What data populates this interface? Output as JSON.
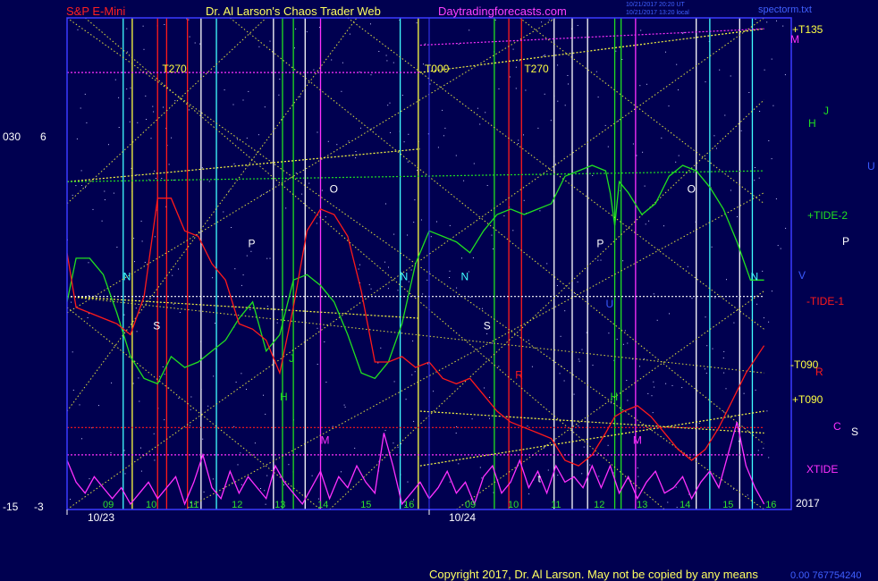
{
  "header": {
    "left": "S&P E-Mini",
    "center": "Dr. Al Larson's Chaos Trader Web",
    "site": "Daytradingforecasts.com",
    "stamp1": "10/21/2017 20:20 UT",
    "stamp2": "10/21/2017 13:20 local",
    "file": "spectorm.txt"
  },
  "footer": {
    "copyright": "Copyright 2017, Dr. Al Larson. May not be copied by any means",
    "code": "0.00 767754240",
    "year": "2017"
  },
  "colors": {
    "background": "#000050",
    "plot_border": "#3a3aff",
    "red": "#ff1a1a",
    "green": "#20e020",
    "magenta": "#ff30ff",
    "yellow": "#ffff40",
    "cyan": "#40ffff",
    "white": "#ffffff"
  },
  "chart_data": {
    "type": "line",
    "title": "",
    "xlabel": "",
    "ylabel": "",
    "x_range": [
      8,
      16
    ],
    "y_scales": [
      {
        "top": "030",
        "bottom": "-15"
      },
      {
        "top": "6",
        "bottom": "-3"
      }
    ],
    "dates": [
      "10/23",
      "10/24"
    ],
    "hour_ticks": [
      "09",
      "10",
      "11",
      "12",
      "13",
      "14",
      "15",
      "16",
      "09",
      "10",
      "11",
      "12",
      "13",
      "14",
      "15",
      "16"
    ],
    "right_labels": [
      {
        "text": "+T135",
        "color": "yellow"
      },
      {
        "text": "M",
        "color": "magenta"
      },
      {
        "text": "J",
        "color": "green"
      },
      {
        "text": "H",
        "color": "green"
      },
      {
        "text": "U",
        "color": "blue"
      },
      {
        "text": "+TIDE-2",
        "color": "green"
      },
      {
        "text": "P",
        "color": "white"
      },
      {
        "text": "V",
        "color": "blue"
      },
      {
        "text": "-TIDE-1",
        "color": "red"
      },
      {
        "text": "-T090",
        "color": "yellow"
      },
      {
        "text": "R",
        "color": "red"
      },
      {
        "text": "+T090",
        "color": "yellow"
      },
      {
        "text": "C",
        "color": "magenta"
      },
      {
        "text": "S",
        "color": "white"
      },
      {
        "text": "XTIDE",
        "color": "magenta"
      }
    ],
    "vertical_markers": [
      {
        "x": 8.62,
        "color": "cyan"
      },
      {
        "x": 8.72,
        "color": "yellow"
      },
      {
        "x": 9.0,
        "color": "red"
      },
      {
        "x": 9.1,
        "color": "red"
      },
      {
        "x": 9.33,
        "color": "red"
      },
      {
        "x": 9.48,
        "color": "white"
      },
      {
        "x": 9.65,
        "color": "cyan"
      },
      {
        "x": 10.28,
        "color": "white"
      },
      {
        "x": 10.38,
        "color": "green"
      },
      {
        "x": 10.5,
        "color": "green"
      },
      {
        "x": 10.63,
        "color": "white"
      },
      {
        "x": 10.8,
        "color": "magenta"
      },
      {
        "x": 11.68,
        "color": "cyan"
      },
      {
        "x": 11.88,
        "color": "yellow"
      },
      {
        "x": 12.72,
        "color": "green"
      },
      {
        "x": 12.88,
        "color": "red"
      },
      {
        "x": 13.02,
        "color": "red"
      },
      {
        "x": 13.38,
        "color": "white"
      },
      {
        "x": 13.58,
        "color": "white"
      },
      {
        "x": 13.75,
        "color": "white"
      },
      {
        "x": 14.05,
        "color": "green"
      },
      {
        "x": 14.12,
        "color": "green"
      },
      {
        "x": 14.28,
        "color": "magenta"
      },
      {
        "x": 14.95,
        "color": "white"
      },
      {
        "x": 15.1,
        "color": "cyan"
      },
      {
        "x": 15.43,
        "color": "white"
      },
      {
        "x": 15.57,
        "color": "cyan"
      }
    ],
    "chart_labels": [
      {
        "text": "T270",
        "x": 9.05,
        "y": 5.0,
        "color": "yellow"
      },
      {
        "text": "T000",
        "x": 11.95,
        "y": 5.0,
        "color": "yellow"
      },
      {
        "text": "T270",
        "x": 13.05,
        "y": 5.0,
        "color": "yellow"
      },
      {
        "text": "O",
        "x": 10.9,
        "y": 2.8,
        "color": "white"
      },
      {
        "text": "O",
        "x": 14.85,
        "y": 2.8,
        "color": "white"
      },
      {
        "text": "P",
        "x": 10.0,
        "y": 1.8,
        "color": "white"
      },
      {
        "text": "P",
        "x": 13.85,
        "y": 1.8,
        "color": "white"
      },
      {
        "text": "N",
        "x": 8.62,
        "y": 1.2,
        "color": "cyan"
      },
      {
        "text": "N",
        "x": 11.68,
        "y": 1.2,
        "color": "cyan"
      },
      {
        "text": "N",
        "x": 12.35,
        "y": 1.2,
        "color": "cyan"
      },
      {
        "text": "N",
        "x": 15.55,
        "y": 1.2,
        "color": "cyan"
      },
      {
        "text": "S",
        "x": 8.95,
        "y": 0.3,
        "color": "white"
      },
      {
        "text": "S",
        "x": 12.6,
        "y": 0.3,
        "color": "white"
      },
      {
        "text": "J",
        "x": 10.45,
        "y": -0.3,
        "color": "green"
      },
      {
        "text": "H",
        "x": 10.35,
        "y": -1.0,
        "color": "green"
      },
      {
        "text": "H",
        "x": 14.0,
        "y": -1.0,
        "color": "green"
      },
      {
        "text": "U",
        "x": 13.95,
        "y": 0.7,
        "color": "blue"
      },
      {
        "text": "R",
        "x": 12.95,
        "y": -0.6,
        "color": "red"
      },
      {
        "text": "M",
        "x": 10.8,
        "y": -1.8,
        "color": "magenta"
      },
      {
        "text": "M",
        "x": 14.25,
        "y": -1.8,
        "color": "magenta"
      },
      {
        "text": "t",
        "x": 13.2,
        "y": -2.5,
        "color": "white"
      }
    ],
    "series": [
      {
        "name": "+TIDE-2",
        "color": "green",
        "x": [
          8.0,
          8.1,
          8.25,
          8.4,
          8.55,
          8.7,
          8.85,
          9.0,
          9.15,
          9.3,
          9.45,
          9.6,
          9.75,
          9.9,
          10.05,
          10.2,
          10.35,
          10.5,
          10.65,
          10.8,
          10.95,
          11.1,
          11.25,
          11.4,
          11.55,
          11.7,
          11.85,
          12.0,
          12.15,
          12.3,
          12.45,
          12.6,
          12.75,
          12.9,
          13.05,
          13.2,
          13.35,
          13.5,
          13.65,
          13.8,
          13.95,
          14.0,
          14.05,
          14.1,
          14.2,
          14.35,
          14.5,
          14.65,
          14.8,
          14.95,
          15.1,
          15.25,
          15.4,
          15.55,
          15.7
        ],
        "y": [
          0.8,
          1.6,
          1.6,
          1.3,
          0.6,
          -0.2,
          -0.6,
          -0.7,
          -0.2,
          -0.4,
          -0.3,
          -0.1,
          0.1,
          0.5,
          0.8,
          -0.1,
          0.2,
          1.2,
          1.3,
          1.1,
          0.8,
          0.2,
          -0.5,
          -0.6,
          -0.3,
          0.4,
          1.5,
          2.1,
          2.0,
          1.9,
          1.7,
          2.1,
          2.4,
          2.5,
          2.4,
          2.5,
          2.6,
          3.1,
          3.2,
          3.3,
          3.2,
          2.8,
          2.2,
          3.0,
          2.8,
          2.4,
          2.6,
          3.1,
          3.3,
          3.2,
          2.9,
          2.5,
          1.9,
          1.2,
          1.2
        ]
      },
      {
        "name": "-TIDE-1",
        "color": "red",
        "x": [
          8.0,
          8.1,
          8.25,
          8.4,
          8.55,
          8.7,
          8.85,
          9.0,
          9.15,
          9.3,
          9.45,
          9.6,
          9.75,
          9.9,
          10.05,
          10.2,
          10.35,
          10.5,
          10.65,
          10.8,
          10.95,
          11.1,
          11.25,
          11.4,
          11.55,
          11.7,
          11.85,
          12.0,
          12.15,
          12.3,
          12.45,
          12.6,
          12.75,
          12.9,
          13.05,
          13.2,
          13.35,
          13.5,
          13.65,
          13.8,
          13.95,
          14.05,
          14.15,
          14.3,
          14.45,
          14.6,
          14.75,
          14.9,
          15.05,
          15.2,
          15.35,
          15.5,
          15.7
        ],
        "y": [
          1.7,
          0.7,
          0.6,
          0.5,
          0.4,
          0.2,
          0.9,
          2.7,
          2.7,
          2.1,
          2.0,
          1.5,
          1.2,
          0.4,
          0.3,
          0.1,
          -0.5,
          0.7,
          2.1,
          2.5,
          2.4,
          2.0,
          1.0,
          -0.3,
          -0.3,
          -0.2,
          -0.4,
          -0.3,
          -0.6,
          -0.7,
          -0.6,
          -0.9,
          -1.2,
          -1.4,
          -1.5,
          -1.6,
          -1.7,
          -2.1,
          -2.2,
          -2.0,
          -1.6,
          -1.3,
          -1.2,
          -1.1,
          -1.3,
          -1.6,
          -1.9,
          -2.1,
          -1.9,
          -1.5,
          -1.0,
          -0.5,
          0.0
        ]
      },
      {
        "name": "XTIDE",
        "color": "magenta",
        "x": [
          8.0,
          8.1,
          8.2,
          8.3,
          8.4,
          8.5,
          8.6,
          8.7,
          8.8,
          8.9,
          9.0,
          9.1,
          9.2,
          9.3,
          9.4,
          9.5,
          9.6,
          9.7,
          9.8,
          9.9,
          10.0,
          10.1,
          10.2,
          10.3,
          10.4,
          10.5,
          10.6,
          10.7,
          10.8,
          10.9,
          11.0,
          11.1,
          11.2,
          11.3,
          11.4,
          11.5,
          11.6,
          11.7,
          11.8,
          11.9,
          12.0,
          12.1,
          12.2,
          12.3,
          12.4,
          12.5,
          12.6,
          12.7,
          12.8,
          12.9,
          13.0,
          13.1,
          13.2,
          13.3,
          13.4,
          13.5,
          13.6,
          13.7,
          13.8,
          13.9,
          14.0,
          14.1,
          14.2,
          14.3,
          14.4,
          14.5,
          14.6,
          14.7,
          14.8,
          14.9,
          15.0,
          15.1,
          15.2,
          15.3,
          15.4,
          15.5,
          15.6,
          15.7
        ],
        "y": [
          -2.1,
          -2.5,
          -2.7,
          -2.4,
          -2.6,
          -2.8,
          -2.6,
          -2.9,
          -2.7,
          -2.5,
          -2.8,
          -2.6,
          -2.4,
          -2.9,
          -2.5,
          -2.0,
          -2.6,
          -2.8,
          -2.3,
          -2.7,
          -2.4,
          -2.6,
          -2.8,
          -2.2,
          -2.5,
          -2.7,
          -2.9,
          -2.6,
          -2.3,
          -2.8,
          -2.4,
          -2.6,
          -2.2,
          -2.5,
          -2.7,
          -1.6,
          -2.2,
          -2.9,
          -2.7,
          -2.5,
          -2.8,
          -2.6,
          -2.3,
          -2.7,
          -2.5,
          -2.9,
          -2.4,
          -2.2,
          -2.7,
          -2.5,
          -2.1,
          -2.6,
          -2.3,
          -2.7,
          -2.2,
          -2.5,
          -2.4,
          -2.6,
          -2.2,
          -2.6,
          -2.2,
          -2.7,
          -2.4,
          -2.8,
          -2.5,
          -2.3,
          -2.7,
          -2.6,
          -2.4,
          -2.8,
          -2.5,
          -2.3,
          -2.6,
          -2.0,
          -1.4,
          -2.2,
          -2.6,
          -2.9
        ]
      }
    ],
    "channel_lines": [
      {
        "x1": 8.0,
        "y1": 0.9,
        "x2": 11.9,
        "y2": 0.5,
        "color": "yellow"
      },
      {
        "x1": 8.0,
        "y1": 3.0,
        "x2": 11.9,
        "y2": 3.6,
        "color": "yellow"
      },
      {
        "x1": 11.9,
        "y1": -1.2,
        "x2": 15.7,
        "y2": -1.6,
        "color": "yellow"
      },
      {
        "x1": 11.9,
        "y1": 5.0,
        "x2": 15.7,
        "y2": 5.8,
        "color": "yellow"
      },
      {
        "x1": 11.9,
        "y1": -2.2,
        "x2": 15.7,
        "y2": -1.2,
        "color": "yellow"
      },
      {
        "x1": 8.0,
        "y1": 3.0,
        "x2": 15.7,
        "y2": 3.2,
        "color": "green"
      },
      {
        "x1": 8.0,
        "y1": 5.0,
        "x2": 11.9,
        "y2": 5.0,
        "color": "magenta"
      },
      {
        "x1": 11.9,
        "y1": 5.5,
        "x2": 15.7,
        "y2": 5.8,
        "color": "magenta"
      },
      {
        "x1": 8.0,
        "y1": -2.0,
        "x2": 15.7,
        "y2": -2.0,
        "color": "magenta"
      },
      {
        "x1": 8.0,
        "y1": 0.9,
        "x2": 15.7,
        "y2": 0.9,
        "color": "white"
      },
      {
        "x1": 8.0,
        "y1": -1.5,
        "x2": 15.7,
        "y2": -1.5,
        "color": "red"
      }
    ],
    "diagonals": [
      {
        "x1": 8.0,
        "y1": 6.0,
        "x2": 15.7,
        "y2": -3.0
      },
      {
        "x1": 8.0,
        "y1": -3.0,
        "x2": 15.7,
        "y2": 6.0
      },
      {
        "x1": 8.0,
        "y1": 2.6,
        "x2": 10.2,
        "y2": 6.0
      },
      {
        "x1": 8.0,
        "y1": 0.6,
        "x2": 13.4,
        "y2": 6.0
      },
      {
        "x1": 8.2,
        "y1": 6.0,
        "x2": 14.6,
        "y2": -3.0
      },
      {
        "x1": 8.0,
        "y1": 0.7,
        "x2": 10.8,
        "y2": -3.0
      },
      {
        "x1": 9.8,
        "y1": 6.0,
        "x2": 15.7,
        "y2": -1.8
      },
      {
        "x1": 11.1,
        "y1": 6.0,
        "x2": 15.7,
        "y2": 0.3
      },
      {
        "x1": 13.0,
        "y1": 6.0,
        "x2": 15.7,
        "y2": 2.6
      },
      {
        "x1": 8.0,
        "y1": 0.9,
        "x2": 15.7,
        "y2": -0.5
      },
      {
        "x1": 9.3,
        "y1": -3.0,
        "x2": 15.7,
        "y2": 2.8
      },
      {
        "x1": 12.3,
        "y1": -3.0,
        "x2": 15.7,
        "y2": 1.0
      },
      {
        "x1": 8.0,
        "y1": -1.2,
        "x2": 11.2,
        "y2": 6.0
      },
      {
        "x1": 10.9,
        "y1": -3.0,
        "x2": 15.7,
        "y2": 4.5
      }
    ]
  }
}
